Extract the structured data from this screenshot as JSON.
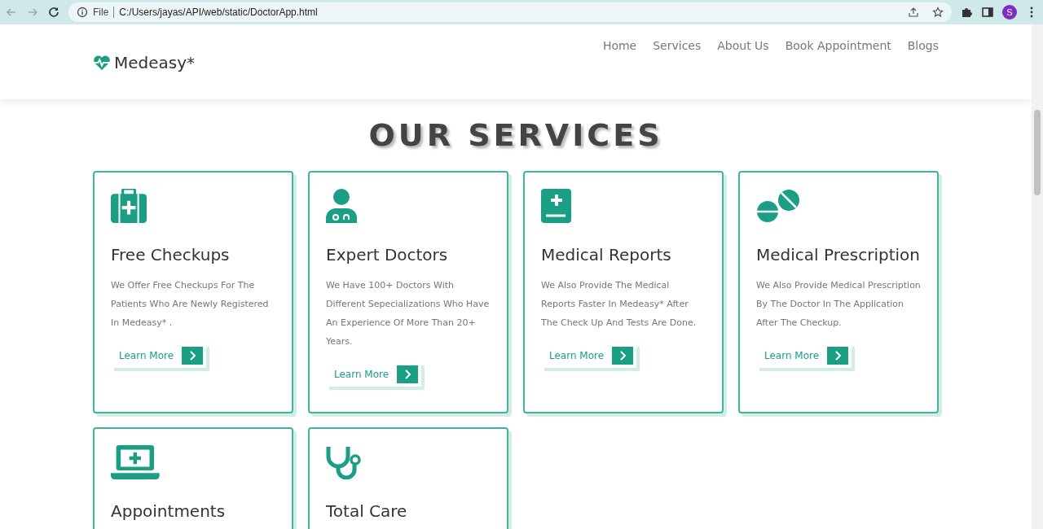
{
  "browser": {
    "scheme": "File",
    "url": "C:/Users/jayas/API/web/static/DoctorApp.html",
    "profile": "S"
  },
  "nav": {
    "logo": "Medeasy*",
    "links": [
      "Home",
      "Services",
      "About Us",
      "Book Appointment",
      "Blogs"
    ]
  },
  "heading": "OUR SERVICES",
  "services": [
    {
      "title": "Free Checkups",
      "description": "We Offer Free Checkups For The Patients Who Are Newly Registered In Medeasy* .",
      "button": "Learn More"
    },
    {
      "title": "Expert Doctors",
      "description": "We Have 100+ Doctors With Different Sepecializations Who Have An Experience Of More Than 20+ Years.",
      "button": "Learn More"
    },
    {
      "title": "Medical Reports",
      "description": "We Also Provide The Medical Reports Faster In Medeasy* After The Check Up And Tests Are Done.",
      "button": "Learn More"
    },
    {
      "title": "Medical Prescription",
      "description": "We Also Provide Medical Prescription By The Doctor In The Application After The Checkup.",
      "button": "Learn More"
    },
    {
      "title": "Appointments"
    },
    {
      "title": "Total Care"
    }
  ]
}
